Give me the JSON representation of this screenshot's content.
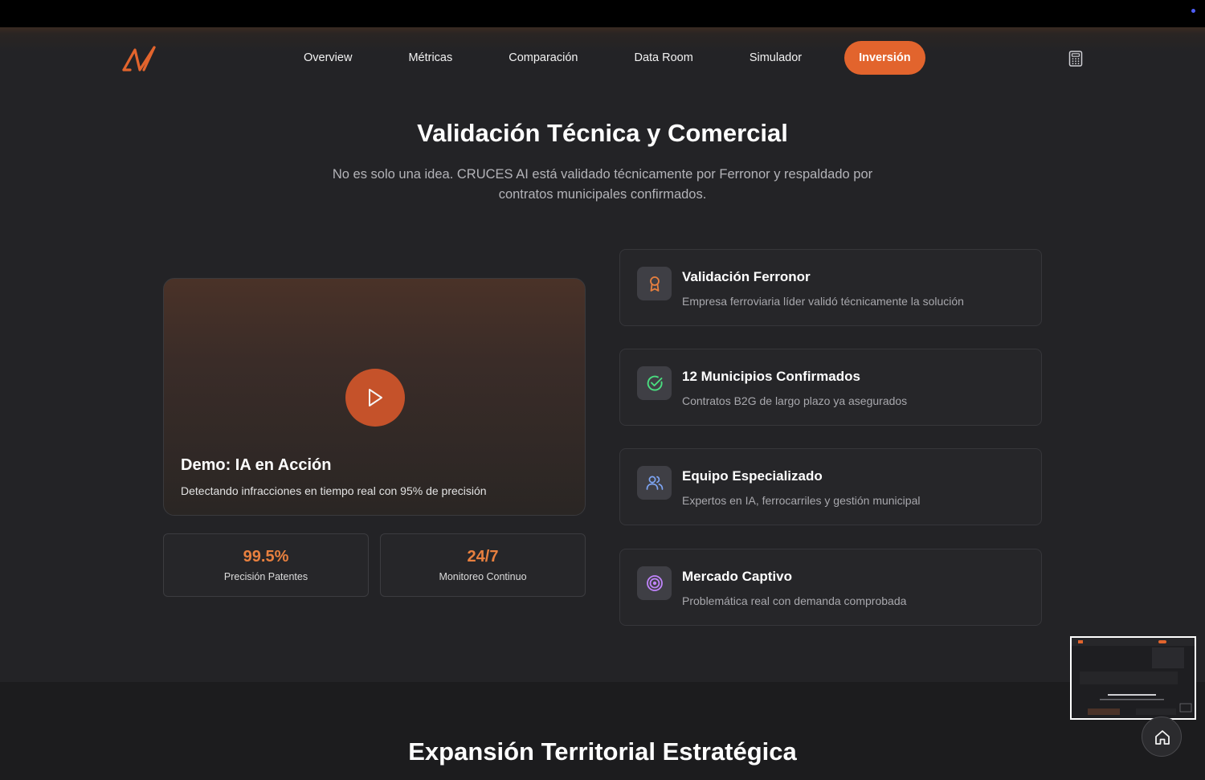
{
  "nav": {
    "links": [
      "Overview",
      "Métricas",
      "Comparación",
      "Data Room",
      "Simulador"
    ],
    "cta": "Inversión"
  },
  "validation": {
    "title": "Validación Técnica y Comercial",
    "subtitle": "No es solo una idea. CRUCES AI está validado técnicamente por Ferronor y respaldado por contratos municipales confirmados."
  },
  "demo": {
    "title": "Demo: IA en Acción",
    "description": "Detectando infracciones en tiempo real con 95% de precisión"
  },
  "stats": [
    {
      "value": "99.5%",
      "label": "Precisión Patentes"
    },
    {
      "value": "24/7",
      "label": "Monitoreo Continuo"
    }
  ],
  "features": [
    {
      "icon": "award-icon",
      "title": "Validación Ferronor",
      "description": "Empresa ferroviaria líder validó técnicamente la solución",
      "color": "#e8803f"
    },
    {
      "icon": "check-circle-icon",
      "title": "12 Municipios Confirmados",
      "description": "Contratos B2G de largo plazo ya asegurados",
      "color": "#4ade80"
    },
    {
      "icon": "users-icon",
      "title": "Equipo Especializado",
      "description": "Expertos en IA, ferrocarriles y gestión municipal",
      "color": "#7ea6f5"
    },
    {
      "icon": "target-icon",
      "title": "Mercado Captivo",
      "description": "Problemática real con demanda comprobada",
      "color": "#c084fc"
    }
  ],
  "expansion": {
    "title": "Expansión Territorial Estratégica"
  },
  "colors": {
    "accent": "#e2642d",
    "background": "#232326"
  }
}
